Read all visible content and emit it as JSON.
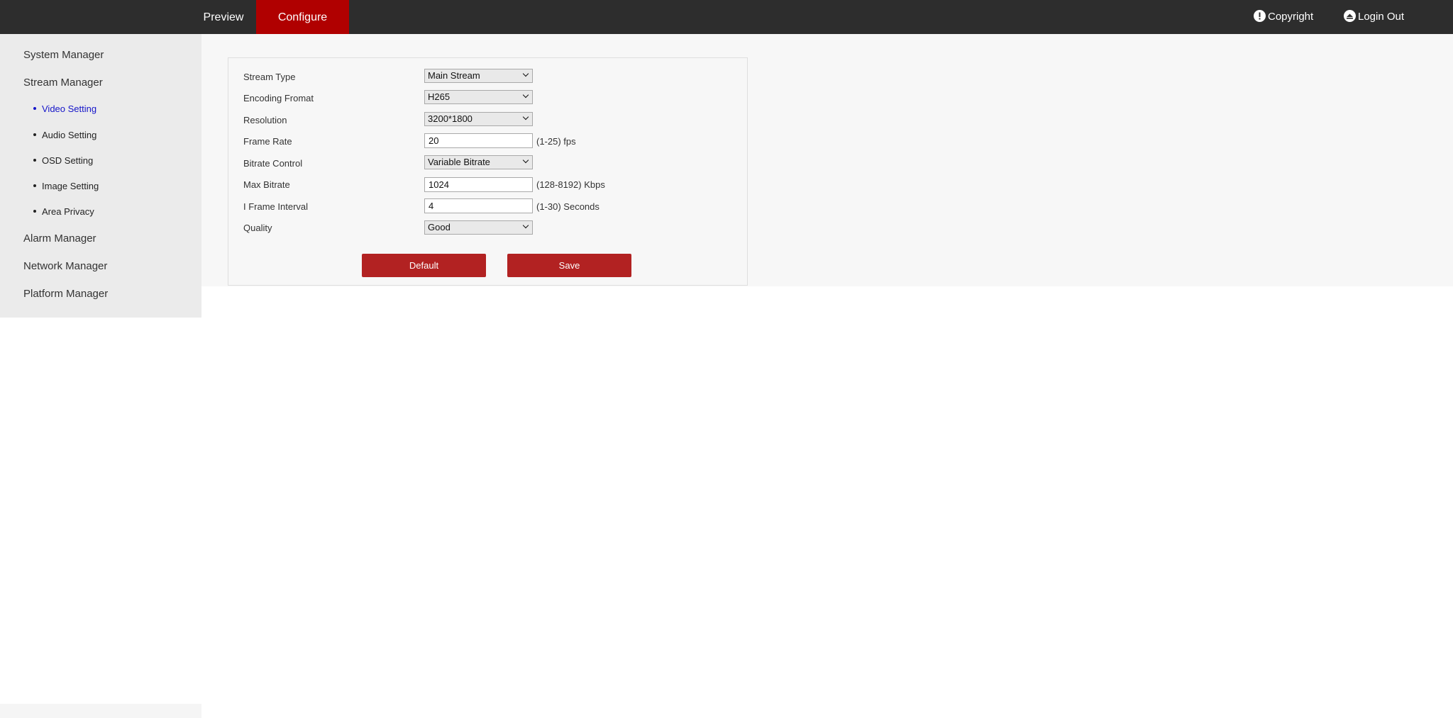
{
  "topnav": {
    "tabs": [
      {
        "label": "Preview",
        "active": false
      },
      {
        "label": "Configure",
        "active": true
      }
    ],
    "copyright": {
      "label": "Copyright",
      "icon": "alert-circle-icon"
    },
    "logout": {
      "label": "Login Out",
      "icon": "logout-icon"
    }
  },
  "sidebar": {
    "items": [
      {
        "label": "System Manager"
      },
      {
        "label": "Stream Manager"
      },
      {
        "label": "Alarm Manager"
      },
      {
        "label": "Network Manager"
      },
      {
        "label": "Platform Manager"
      }
    ],
    "stream_subitems": [
      {
        "label": "Video Setting",
        "active": true
      },
      {
        "label": "Audio Setting",
        "active": false
      },
      {
        "label": "OSD Setting",
        "active": false
      },
      {
        "label": "Image Setting",
        "active": false
      },
      {
        "label": "Area Privacy",
        "active": false
      }
    ]
  },
  "form": {
    "fields": [
      {
        "label": "Stream Type",
        "type": "select",
        "value": "Main Stream"
      },
      {
        "label": "Encoding Fromat",
        "type": "select",
        "value": "H265"
      },
      {
        "label": "Resolution",
        "type": "select",
        "value": "3200*1800"
      },
      {
        "label": "Frame Rate",
        "type": "input",
        "value": "20",
        "hint": "(1-25) fps"
      },
      {
        "label": "Bitrate Control",
        "type": "select",
        "value": "Variable Bitrate"
      },
      {
        "label": "Max Bitrate",
        "type": "input",
        "value": "1024",
        "hint": "(128-8192) Kbps"
      },
      {
        "label": "I Frame Interval",
        "type": "input",
        "value": "4",
        "hint": "(1-30) Seconds"
      },
      {
        "label": "Quality",
        "type": "select",
        "value": "Good"
      }
    ],
    "buttons": {
      "default_label": "Default",
      "save_label": "Save"
    }
  },
  "colors": {
    "topbar": "#2d2d2d",
    "accent": "#b00000",
    "button": "#b22222",
    "active_link": "#1515c9",
    "sidebar": "#ebebeb"
  }
}
